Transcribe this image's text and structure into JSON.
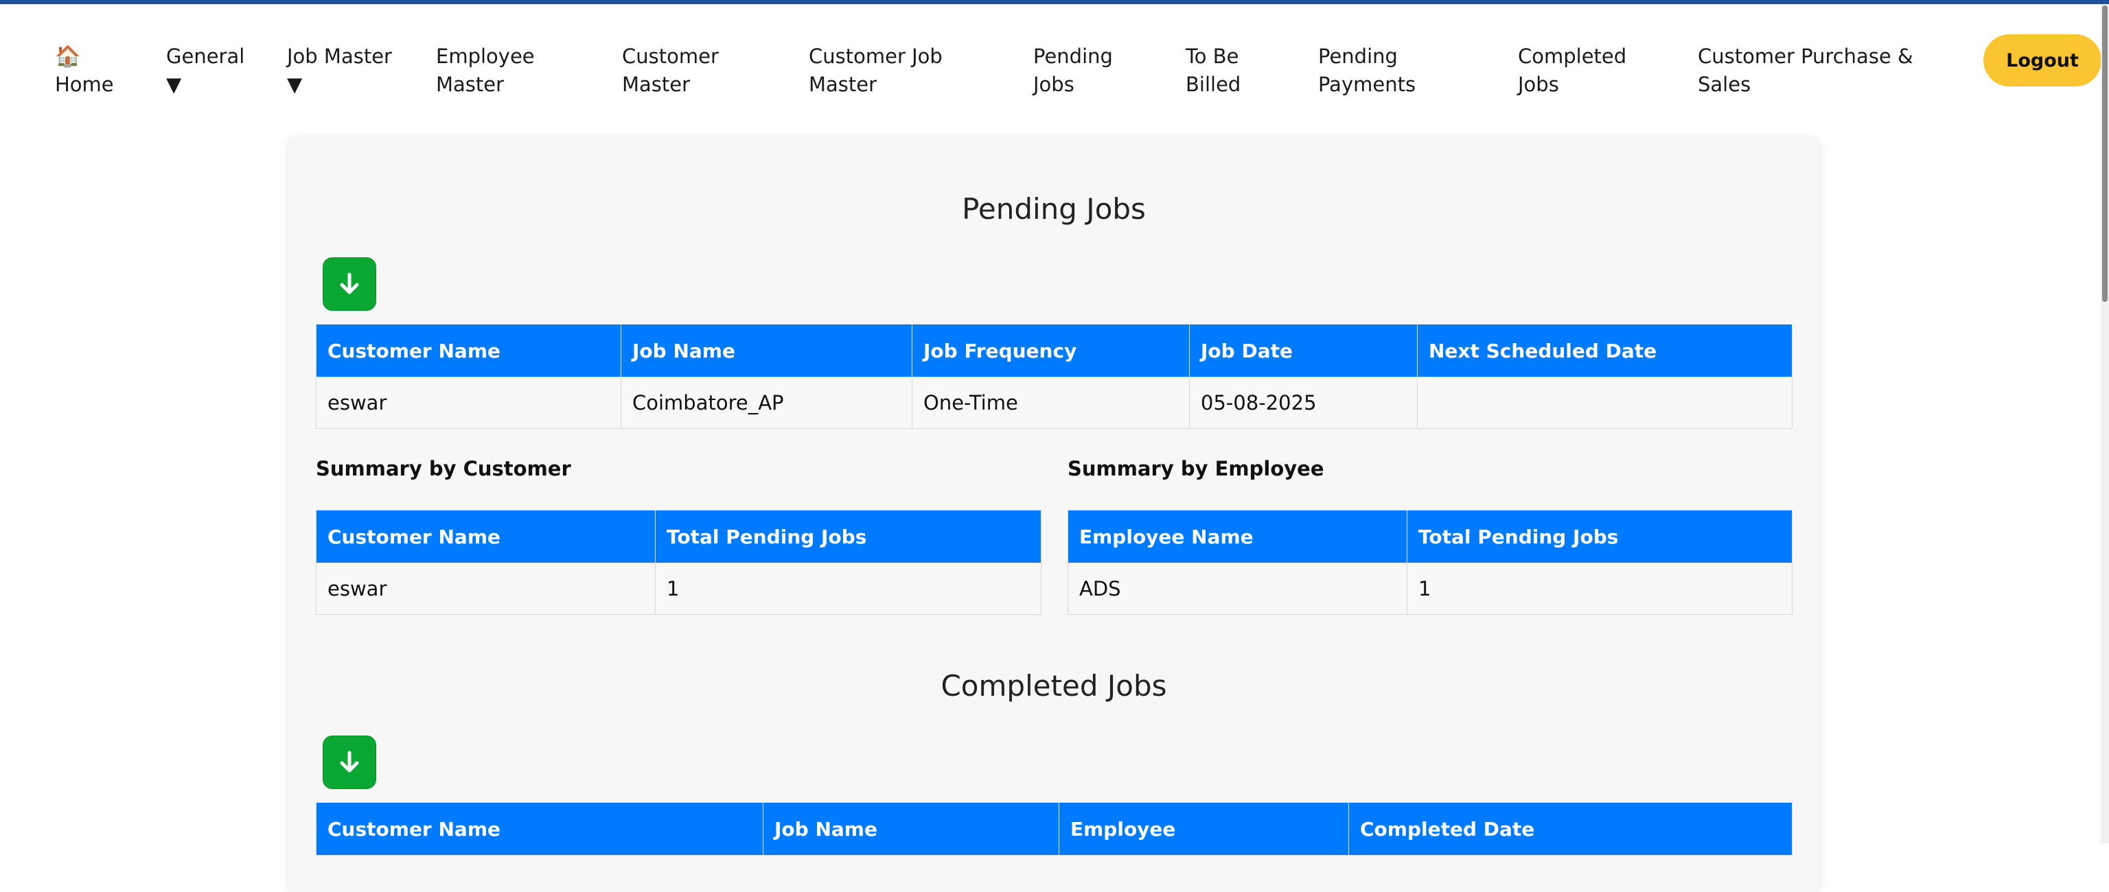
{
  "nav": {
    "home": {
      "icon": "home-icon",
      "label": "Home"
    },
    "items": [
      {
        "line1": "General",
        "line2": "▼"
      },
      {
        "line1": "Job Master",
        "line2": "▼"
      },
      {
        "line1": "Employee",
        "line2": "Master"
      },
      {
        "line1": "Customer",
        "line2": "Master"
      },
      {
        "line1": "Customer Job",
        "line2": "Master"
      },
      {
        "line1": "Pending",
        "line2": "Jobs"
      },
      {
        "line1": "To Be",
        "line2": "Billed"
      },
      {
        "line1": "Pending",
        "line2": "Payments"
      },
      {
        "line1": "Completed",
        "line2": "Jobs"
      },
      {
        "line1": "Customer Purchase &",
        "line2": "Sales"
      }
    ],
    "logout": "Logout"
  },
  "pending": {
    "title": "Pending Jobs",
    "download_icon": "download-arrow-icon",
    "headers": [
      "Customer Name",
      "Job Name",
      "Job Frequency",
      "Job Date",
      "Next Scheduled Date"
    ],
    "rows": [
      [
        "eswar",
        "Coimbatore_AP",
        "One-Time",
        "05-08-2025",
        ""
      ]
    ]
  },
  "summary_customer": {
    "title": "Summary by Customer",
    "headers": [
      "Customer Name",
      "Total Pending Jobs"
    ],
    "rows": [
      [
        "eswar",
        "1"
      ]
    ]
  },
  "summary_employee": {
    "title": "Summary by Employee",
    "headers": [
      "Employee Name",
      "Total Pending Jobs"
    ],
    "rows": [
      [
        "ADS",
        "1"
      ]
    ]
  },
  "completed": {
    "title": "Completed Jobs",
    "download_icon": "download-arrow-icon",
    "headers": [
      "Customer Name",
      "Job Name",
      "Employee",
      "Completed Date"
    ]
  },
  "colors": {
    "header_blue": "#007bff",
    "download_green": "#0aa832",
    "logout_yellow": "#fbc531",
    "top_bar": "#1d4f91"
  }
}
